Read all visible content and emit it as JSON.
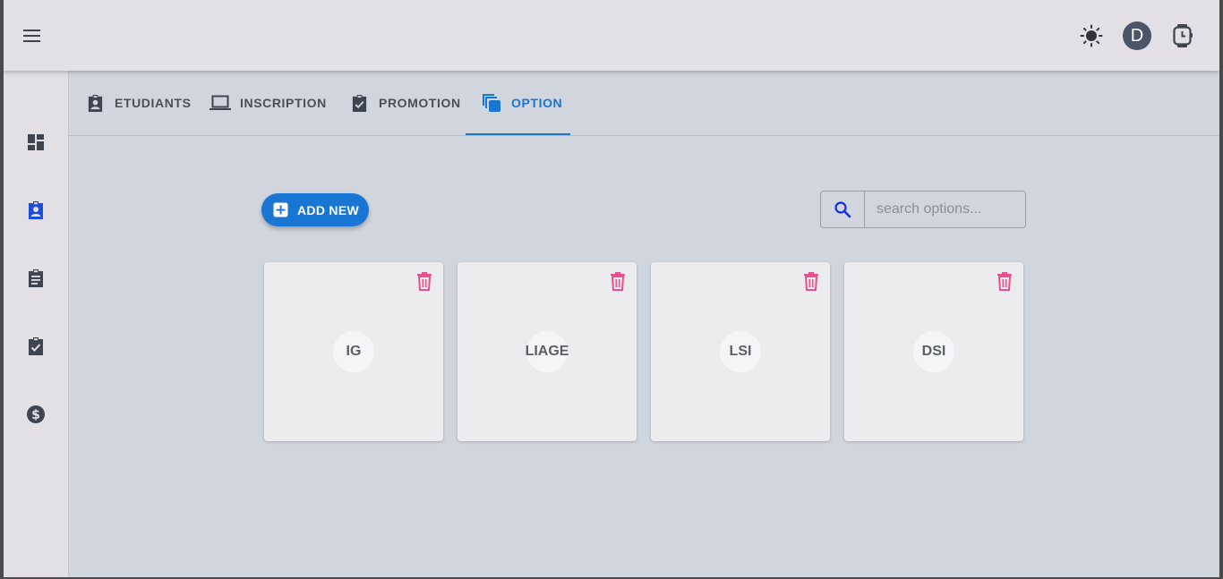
{
  "header": {
    "menu_icon": "menu-icon",
    "theme_icon": "sun-icon",
    "avatar_initial": "D",
    "watch_icon": "watch-icon"
  },
  "sidebar": {
    "items": [
      {
        "name": "dashboard",
        "icon": "dashboard-icon"
      },
      {
        "name": "students",
        "icon": "badge-icon",
        "active": true
      },
      {
        "name": "assignments",
        "icon": "clipboard-icon"
      },
      {
        "name": "validations",
        "icon": "clipboard-check-icon"
      },
      {
        "name": "payments",
        "icon": "dollar-icon"
      }
    ]
  },
  "tabs": [
    {
      "label": "ETUDIANTS",
      "icon": "badge-icon"
    },
    {
      "label": "INSCRIPTION",
      "icon": "laptop-icon"
    },
    {
      "label": "PROMOTION",
      "icon": "clipboard-check-icon"
    },
    {
      "label": "OPTION",
      "icon": "library-icon",
      "active": true
    }
  ],
  "toolbar": {
    "add_label": "ADD NEW",
    "search_placeholder": "search options..."
  },
  "options": [
    {
      "label": "IG"
    },
    {
      "label": "LIAGE"
    },
    {
      "label": "LSI"
    },
    {
      "label": "DSI"
    }
  ],
  "colors": {
    "accent": "#1976d2",
    "delete": "#e8508f",
    "background": "#d1d5de",
    "bar": "#e2dfe5"
  }
}
